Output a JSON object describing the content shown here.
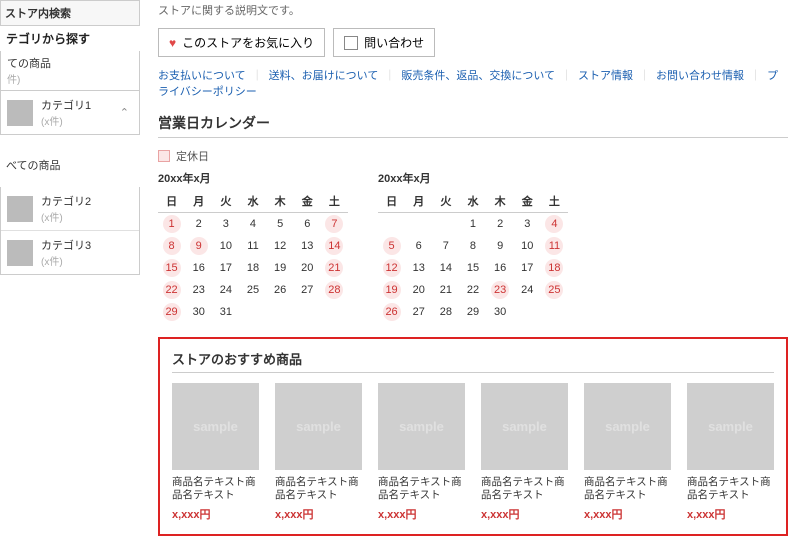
{
  "sidebar": {
    "search_box_label": "ストア内検索",
    "browse_title": "テゴリから探す",
    "all_items_top": "ての商品",
    "all_items_count": "件)",
    "cat1": {
      "name": "カテゴリ1",
      "count": "(x件)",
      "caret": "⌃"
    },
    "all_mid": "べての商品",
    "cat2": {
      "name": "カテゴリ2",
      "count": "(x件)"
    },
    "cat3": {
      "name": "カテゴリ3",
      "count": "(x件)"
    }
  },
  "store": {
    "desc": "ストアに関する説明文です。",
    "fav_label": "このストアをお気に入り",
    "contact_label": "問い合わせ"
  },
  "info_links": [
    "お支払いについて",
    "送料、お届けについて",
    "販売条件、返品、交換について",
    "ストア情報",
    "お問い合わせ情報",
    "プライバシーポリシー"
  ],
  "calendar": {
    "section_title": "営業日カレンダー",
    "legend": "定休日",
    "dow": [
      "日",
      "月",
      "火",
      "水",
      "木",
      "金",
      "土"
    ],
    "months": [
      {
        "title": "20xx年x月",
        "weeks": [
          [
            {
              "d": 1,
              "off": true
            },
            {
              "d": 2
            },
            {
              "d": 3
            },
            {
              "d": 4
            },
            {
              "d": 5
            },
            {
              "d": 6
            },
            {
              "d": 7,
              "off": true
            }
          ],
          [
            {
              "d": 8,
              "off": true
            },
            {
              "d": 9,
              "off": true
            },
            {
              "d": 10
            },
            {
              "d": 11
            },
            {
              "d": 12
            },
            {
              "d": 13
            },
            {
              "d": 14,
              "off": true
            }
          ],
          [
            {
              "d": 15,
              "off": true
            },
            {
              "d": 16
            },
            {
              "d": 17
            },
            {
              "d": 18
            },
            {
              "d": 19
            },
            {
              "d": 20
            },
            {
              "d": 21,
              "off": true
            }
          ],
          [
            {
              "d": 22,
              "off": true
            },
            {
              "d": 23
            },
            {
              "d": 24
            },
            {
              "d": 25
            },
            {
              "d": 26
            },
            {
              "d": 27
            },
            {
              "d": 28,
              "off": true
            }
          ],
          [
            {
              "d": 29,
              "off": true
            },
            {
              "d": 30
            },
            {
              "d": 31
            },
            {
              "d": null
            },
            {
              "d": null
            },
            {
              "d": null
            },
            {
              "d": null
            }
          ]
        ]
      },
      {
        "title": "20xx年x月",
        "weeks": [
          [
            {
              "d": null
            },
            {
              "d": null
            },
            {
              "d": null
            },
            {
              "d": 1
            },
            {
              "d": 2
            },
            {
              "d": 3
            },
            {
              "d": 4,
              "off": true
            }
          ],
          [
            {
              "d": 5,
              "off": true
            },
            {
              "d": 6
            },
            {
              "d": 7
            },
            {
              "d": 8
            },
            {
              "d": 9
            },
            {
              "d": 10
            },
            {
              "d": 11,
              "off": true
            }
          ],
          [
            {
              "d": 12,
              "off": true
            },
            {
              "d": 13
            },
            {
              "d": 14
            },
            {
              "d": 15
            },
            {
              "d": 16
            },
            {
              "d": 17
            },
            {
              "d": 18,
              "off": true
            }
          ],
          [
            {
              "d": 19,
              "off": true
            },
            {
              "d": 20
            },
            {
              "d": 21
            },
            {
              "d": 22
            },
            {
              "d": 23,
              "off": true
            },
            {
              "d": 24
            },
            {
              "d": 25,
              "off": true
            }
          ],
          [
            {
              "d": 26,
              "off": true
            },
            {
              "d": 27
            },
            {
              "d": 28
            },
            {
              "d": 29
            },
            {
              "d": 30
            },
            {
              "d": null
            },
            {
              "d": null
            }
          ]
        ]
      }
    ]
  },
  "reco": {
    "title": "ストアのおすすめ商品",
    "thumb_text": "sample",
    "items": [
      {
        "name": "商品名テキスト商品名テキスト",
        "price": "x,xxx円"
      },
      {
        "name": "商品名テキスト商品名テキスト",
        "price": "x,xxx円"
      },
      {
        "name": "商品名テキスト商品名テキスト",
        "price": "x,xxx円"
      },
      {
        "name": "商品名テキスト商品名テキスト",
        "price": "x,xxx円"
      },
      {
        "name": "商品名テキスト商品名テキスト",
        "price": "x,xxx円"
      },
      {
        "name": "商品名テキスト商品名テキスト",
        "price": "x,xxx円"
      }
    ]
  }
}
